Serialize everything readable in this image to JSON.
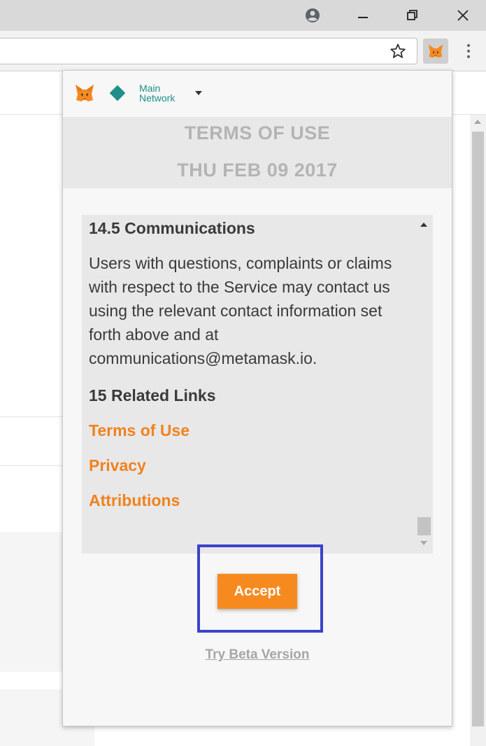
{
  "colors": {
    "accent_orange": "#f68a1f",
    "link_orange": "#f0821e",
    "network_teal": "#1f8f8a",
    "highlight_blue": "#3a44c8"
  },
  "window_controls": {
    "icons": [
      "account-circle-icon",
      "minimize-icon",
      "restore-icon",
      "close-icon"
    ]
  },
  "toolbar": {
    "omnibox_value": "",
    "icons": [
      "bookmark-star-icon",
      "metamask-extension-icon",
      "chrome-menu-icon"
    ]
  },
  "popup": {
    "network": {
      "line1": "Main",
      "line2": "Network"
    },
    "terms_title": "TERMS OF USE",
    "terms_date": "THU FEB 09 2017",
    "tos": {
      "heading_1": "14.5 Communications",
      "paragraph": "Users with questions, complaints or claims with respect to the Service may contact us using the relevant contact information set forth above and at communications@metamask.io.",
      "heading_2": "15 Related Links",
      "links": [
        "Terms of Use",
        "Privacy",
        "Attributions"
      ]
    },
    "accept_label": "Accept",
    "beta_label": "Try Beta Version"
  }
}
